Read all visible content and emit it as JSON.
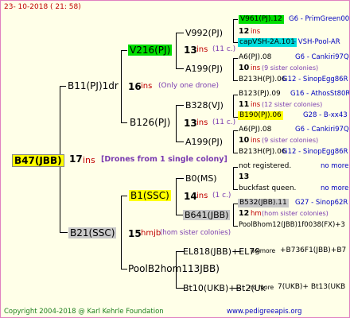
{
  "header": {
    "date": "23- 10-2018 ( 21: 58)"
  },
  "footer": {
    "copyright": "Copyright 2004-2018 @ Karl Kehrle Foundation",
    "site": "www.pedigreeapis.org"
  },
  "root": {
    "label": "B47(JBB)",
    "ins": "17",
    "ins_word": "ins",
    "note": "[Drones from 1 single colony]"
  },
  "sire": {
    "label": "B11(PJ)1dr",
    "ins": "16",
    "ins_word": "ins",
    "note": "(Only one drone)"
  },
  "dam": {
    "label": "B21(SSC)",
    "ins": "15",
    "ins_word": "hmjb",
    "note": "(hom sister colonies)"
  },
  "ss": {
    "label": "V216(PJ)",
    "ins": "13",
    "ins_word": "ins",
    "note": "(11 c.)"
  },
  "sd": {
    "label": "B126(PJ)",
    "ins": "13",
    "ins_word": "ins",
    "note": "(11 c.)"
  },
  "ds": {
    "label": "B1(SSC)",
    "ins": "14",
    "ins_word": "ins",
    "note": "(1 c.)"
  },
  "dd": {
    "label": "PoolB2hom113JBB)"
  },
  "g3": {
    "a": "V992(PJ)",
    "b": "A199(PJ)",
    "c": "B328(VJ)",
    "d": "A199(PJ)",
    "e": "B0(MS)",
    "f": "B641(JBB)",
    "g": "EL818(JBB)+EL79",
    "h": "Bt10(UKB)+Bt2(Uk"
  },
  "g4": {
    "r1": {
      "label": "V961(PJ).12",
      "extra": "G6 - PrimGreen00"
    },
    "r2": {
      "num": "12",
      "word": "ins"
    },
    "r3": {
      "label": "capVSH-2A.101",
      "extra": "- VSH-Pool-AR"
    },
    "r4": {
      "label": "A6(PJ).08",
      "extra": "G6 - Cankiri97Q"
    },
    "r5": {
      "num": "10",
      "word": "ins",
      "note": "(9 sister colonies)"
    },
    "r6": {
      "label": "B213H(PJ).06",
      "extra": "G12 - SinopEgg86R"
    },
    "r7": {
      "label": "B123(PJ).09",
      "extra": "G16 - AthosSt80R"
    },
    "r8": {
      "num": "11",
      "word": "ins",
      "note": "(12 sister colonies)"
    },
    "r9": {
      "label": "B190(PJ).06",
      "extra": "G28 - B-xx43"
    },
    "r10": {
      "label": "A6(PJ).08",
      "extra": "G6 - Cankiri97Q"
    },
    "r11": {
      "num": "10",
      "word": "ins",
      "note": "(9 sister colonies)"
    },
    "r12": {
      "label": "B213H(PJ).06",
      "extra": "G12 - SinopEgg86R"
    },
    "r13": {
      "label": "not registered.",
      "extra": "no more"
    },
    "r14": {
      "num": "13"
    },
    "r15": {
      "label": "buckfast queen.",
      "extra": "no more"
    },
    "r16": {
      "label": "B532(JBB).11",
      "extra": "G27 - Sinop62R"
    },
    "r17": {
      "num": "12",
      "word": "hm",
      "note": "(hom sister colonies)"
    },
    "r18": {
      "label": "PoolBhom12(JBB)1f0038(FX)+3"
    },
    "r19": {
      "label": "no more",
      "extra": "+B736F1(JBB)+B7"
    },
    "r20": {
      "label": "no more",
      "extra": "7(UKB)+ Bt13(UKB"
    }
  }
}
